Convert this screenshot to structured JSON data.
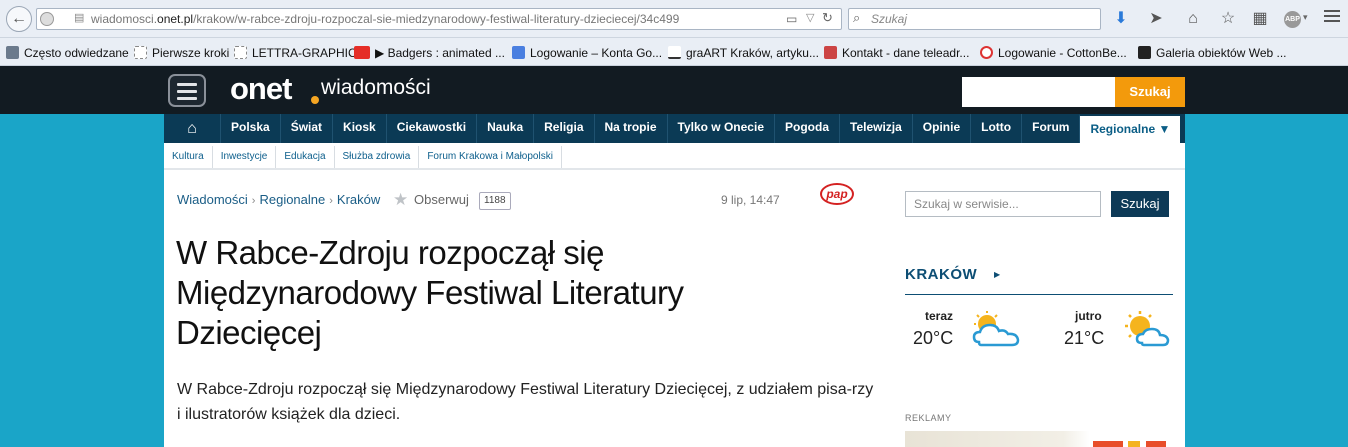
{
  "browser": {
    "url_prefix": "wiadomosci.",
    "url_host": "onet.pl",
    "url_path": "/krakow/w-rabce-zdroju-rozpoczal-sie-miedzynarodowy-festiwal-literatury-dzieciecej/34c499",
    "search_placeholder": "Szukaj",
    "addon_badge": "ABP"
  },
  "bookmarks": [
    {
      "label": "Często odwiedzane",
      "icon": "gear-icon",
      "color": "#6b7a8c"
    },
    {
      "label": "Pierwsze kroki",
      "icon": "page-icon",
      "color": "#ffffff"
    },
    {
      "label": "LETTRA-GRAPHIC",
      "icon": "page-icon",
      "color": "#ffffff"
    },
    {
      "label": "▶ Badgers : animated ...",
      "icon": "youtube-icon",
      "color": "#e52d27"
    },
    {
      "label": "Logowanie – Konta Go...",
      "icon": "google-icon",
      "color": "#4a7fe0"
    },
    {
      "label": "graART Kraków, artyku...",
      "icon": "graart-icon",
      "color": "#333333"
    },
    {
      "label": "Kontakt - dane teleadr...",
      "icon": "site-icon",
      "color": "#c44"
    },
    {
      "label": "Logowanie - CottonBe...",
      "icon": "cotton-icon",
      "color": "#d33"
    },
    {
      "label": "Galeria obiektów Web ...",
      "icon": "gallery-icon",
      "color": "#222"
    }
  ],
  "header": {
    "logo": "onet",
    "section": "wiadomości",
    "search_button": "Szukaj"
  },
  "mainnav": [
    "Polska",
    "Świat",
    "Kiosk",
    "Ciekawostki",
    "Nauka",
    "Religia",
    "Na tropie",
    "Tylko w Onecie",
    "Pogoda",
    "Telewizja",
    "Opinie",
    "Lotto",
    "Forum",
    "Regionalne ▼"
  ],
  "subnav": [
    "Kultura",
    "Inwestycje",
    "Edukacja",
    "Służba zdrowia",
    "Forum Krakowa i Małopolski"
  ],
  "article": {
    "breadcrumb": [
      "Wiadomości",
      "Regionalne",
      "Kraków"
    ],
    "observe": "Obserwuj",
    "observers": "1188",
    "date": "9 lip, 14:47",
    "source": "pap",
    "title": "W Rabce-Zdroju rozpoczął się Międzynarodowy Festiwal Literatury Dziecięcej",
    "lead": "W Rabce-Zdroju rozpoczął się Międzynarodowy Festiwal Literatury Dziecięcej, z udziałem pisa-rzy i ilustratorów książek dla dzieci."
  },
  "sidebar": {
    "search_placeholder": "Szukaj w serwisie...",
    "search_button": "Szukaj",
    "weather": {
      "city": "KRAKÓW",
      "today_label": "teraz",
      "today_temp": "20°C",
      "tomorrow_label": "jutro",
      "tomorrow_temp": "21°C"
    },
    "ads_label": "REKLAMY"
  }
}
